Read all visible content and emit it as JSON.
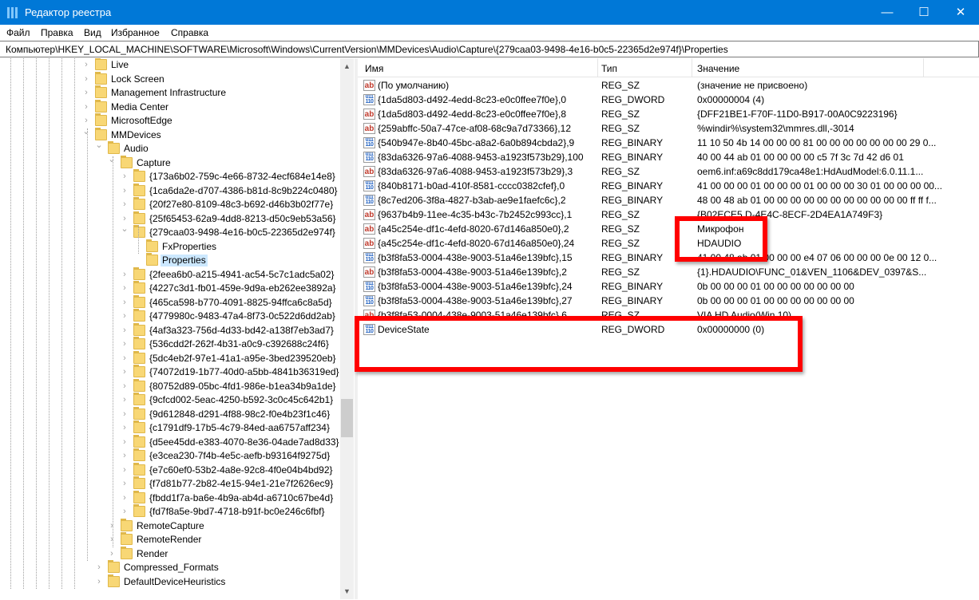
{
  "window": {
    "title": "Редактор реестра",
    "minimize": "—",
    "maximize": "☐",
    "close": "✕"
  },
  "menu": [
    "Файл",
    "Правка",
    "Вид",
    "Избранное",
    "Справка"
  ],
  "address": "Компьютер\\HKEY_LOCAL_MACHINE\\SOFTWARE\\Microsoft\\Windows\\CurrentVersion\\MMDevices\\Audio\\Capture\\{279caa03-9498-4e16-b0c5-22365d2e974f}\\Properties",
  "tree": [
    {
      "label": "Live",
      "level": 0,
      "state": "collapsed"
    },
    {
      "label": "Lock Screen",
      "level": 0,
      "state": "collapsed"
    },
    {
      "label": "Management Infrastructure",
      "level": 0,
      "state": "collapsed"
    },
    {
      "label": "Media Center",
      "level": 0,
      "state": "collapsed"
    },
    {
      "label": "MicrosoftEdge",
      "level": 0,
      "state": "collapsed"
    },
    {
      "label": "MMDevices",
      "level": 0,
      "state": "expanded"
    },
    {
      "label": "Audio",
      "level": 1,
      "state": "expanded"
    },
    {
      "label": "Capture",
      "level": 2,
      "state": "expanded"
    },
    {
      "label": "{173a6b02-759c-4e66-8732-4ecf684e14e8}",
      "level": 3,
      "state": "collapsed"
    },
    {
      "label": "{1ca6da2e-d707-4386-b81d-8c9b224c0480}",
      "level": 3,
      "state": "collapsed"
    },
    {
      "label": "{20f27e80-8109-48c3-b692-d46b3b02f77e}",
      "level": 3,
      "state": "collapsed"
    },
    {
      "label": "{25f65453-62a9-4dd8-8213-d50c9eb53a56}",
      "level": 3,
      "state": "collapsed"
    },
    {
      "label": "{279caa03-9498-4e16-b0c5-22365d2e974f}",
      "level": 3,
      "state": "expanded"
    },
    {
      "label": "FxProperties",
      "level": 4,
      "state": "leaf"
    },
    {
      "label": "Properties",
      "level": 4,
      "state": "leaf",
      "selected": true
    },
    {
      "label": "{2feea6b0-a215-4941-ac54-5c7c1adc5a02}",
      "level": 3,
      "state": "collapsed"
    },
    {
      "label": "{4227c3d1-fb01-459e-9d9a-eb262ee3892a}",
      "level": 3,
      "state": "collapsed"
    },
    {
      "label": "{465ca598-b770-4091-8825-94ffca6c8a5d}",
      "level": 3,
      "state": "collapsed"
    },
    {
      "label": "{4779980c-9483-47a4-8f73-0c522d6dd2ab}",
      "level": 3,
      "state": "collapsed"
    },
    {
      "label": "{4af3a323-756d-4d33-bd42-a138f7eb3ad7}",
      "level": 3,
      "state": "collapsed"
    },
    {
      "label": "{536cdd2f-262f-4b31-a0c9-c392688c24f6}",
      "level": 3,
      "state": "collapsed"
    },
    {
      "label": "{5dc4eb2f-97e1-41a1-a95e-3bed239520eb}",
      "level": 3,
      "state": "collapsed"
    },
    {
      "label": "{74072d19-1b77-40d0-a5bb-4841b36319ed}",
      "level": 3,
      "state": "collapsed"
    },
    {
      "label": "{80752d89-05bc-4fd1-986e-b1ea34b9a1de}",
      "level": 3,
      "state": "collapsed"
    },
    {
      "label": "{9cfcd002-5eac-4250-b592-3c0c45c642b1}",
      "level": 3,
      "state": "collapsed"
    },
    {
      "label": "{9d612848-d291-4f88-98c2-f0e4b23f1c46}",
      "level": 3,
      "state": "collapsed"
    },
    {
      "label": "{c1791df9-17b5-4c79-84ed-aa6757aff234}",
      "level": 3,
      "state": "collapsed"
    },
    {
      "label": "{d5ee45dd-e383-4070-8e36-04ade7ad8d33}",
      "level": 3,
      "state": "collapsed"
    },
    {
      "label": "{e3cea230-7f4b-4e5c-aefb-b93164f9275d}",
      "level": 3,
      "state": "collapsed"
    },
    {
      "label": "{e7c60ef0-53b2-4a8e-92c8-4f0e04b4bd92}",
      "level": 3,
      "state": "collapsed"
    },
    {
      "label": "{f7d81b77-2b82-4e15-94e1-21e7f2626ec9}",
      "level": 3,
      "state": "collapsed"
    },
    {
      "label": "{fbdd1f7a-ba6e-4b9a-ab4d-a6710c67be4d}",
      "level": 3,
      "state": "collapsed"
    },
    {
      "label": "{fd7f8a5e-9bd7-4718-b91f-bc0e246c6fbf}",
      "level": 3,
      "state": "collapsed"
    },
    {
      "label": "RemoteCapture",
      "level": 2,
      "state": "collapsed"
    },
    {
      "label": "RemoteRender",
      "level": 2,
      "state": "collapsed"
    },
    {
      "label": "Render",
      "level": 2,
      "state": "collapsed"
    },
    {
      "label": "Compressed_Formats",
      "level": 1,
      "state": "collapsed"
    },
    {
      "label": "DefaultDeviceHeuristics",
      "level": 1,
      "state": "collapsed"
    }
  ],
  "columns": {
    "name": "Имя",
    "type": "Тип",
    "value": "Значение"
  },
  "values": [
    {
      "name": "(По умолчанию)",
      "type": "REG_SZ",
      "value": "(значение не присвоено)",
      "icon": "string-value-icon"
    },
    {
      "name": "{1da5d803-d492-4edd-8c23-e0c0ffee7f0e},0",
      "type": "REG_DWORD",
      "value": "0x00000004 (4)",
      "icon": "binary-value-icon"
    },
    {
      "name": "{1da5d803-d492-4edd-8c23-e0c0ffee7f0e},8",
      "type": "REG_SZ",
      "value": "{DFF21BE1-F70F-11D0-B917-00A0C9223196}",
      "icon": "string-value-icon"
    },
    {
      "name": "{259abffc-50a7-47ce-af08-68c9a7d73366},12",
      "type": "REG_SZ",
      "value": "%windir%\\system32\\mmres.dll,-3014",
      "icon": "string-value-icon"
    },
    {
      "name": "{540b947e-8b40-45bc-a8a2-6a0b894cbda2},9",
      "type": "REG_BINARY",
      "value": "11 10 50 4b 14 00 00 00 81 00 00 00 00 00 00 00 29 0...",
      "icon": "binary-value-icon"
    },
    {
      "name": "{83da6326-97a6-4088-9453-a1923f573b29},100",
      "type": "REG_BINARY",
      "value": "40 00 44 ab 01 00 00 00 00 c5 7f 3c 7d 42 d6 01",
      "icon": "binary-value-icon"
    },
    {
      "name": "{83da6326-97a6-4088-9453-a1923f573b29},3",
      "type": "REG_SZ",
      "value": "oem6.inf:a69c8dd179ca48e1:HdAudModel:6.0.11.1...",
      "icon": "string-value-icon"
    },
    {
      "name": "{840b8171-b0ad-410f-8581-cccc0382cfef},0",
      "type": "REG_BINARY",
      "value": "41 00 00 00 01 00 00 00 01 00 00 00 30 01 00 00 00 00...",
      "icon": "binary-value-icon"
    },
    {
      "name": "{8c7ed206-3f8a-4827-b3ab-ae9e1faefc6c},2",
      "type": "REG_BINARY",
      "value": "48 00 48 ab 01 00 00 00 00 00 00 00 00 00 00 00 ff ff f...",
      "icon": "binary-value-icon"
    },
    {
      "name": "{9637b4b9-11ee-4c35-b43c-7b2452c993cc},1",
      "type": "REG_SZ",
      "value": "{B02ECE5        D-4E4C-8ECF-2D4EA1A749F3}",
      "icon": "string-value-icon"
    },
    {
      "name": "{a45c254e-df1c-4efd-8020-67d146a850e0},2",
      "type": "REG_SZ",
      "value": "Микрофон",
      "icon": "string-value-icon"
    },
    {
      "name": "{a45c254e-df1c-4efd-8020-67d146a850e0},24",
      "type": "REG_SZ",
      "value": "HDAUDIO",
      "icon": "string-value-icon"
    },
    {
      "name": "{b3f8fa53-0004-438e-9003-51a46e139bfc},15",
      "type": "REG_BINARY",
      "value": "41 00 48 ab 01 00 00 00 e4 07 06 00 00 00 0e 00 12 0...",
      "icon": "binary-value-icon"
    },
    {
      "name": "{b3f8fa53-0004-438e-9003-51a46e139bfc},2",
      "type": "REG_SZ",
      "value": "{1}.HDAUDIO\\FUNC_01&VEN_1106&DEV_0397&S...",
      "icon": "string-value-icon"
    },
    {
      "name": "{b3f8fa53-0004-438e-9003-51a46e139bfc},24",
      "type": "REG_BINARY",
      "value": "0b 00 00 00 01 00 00 00 00 00 00 00",
      "icon": "binary-value-icon"
    },
    {
      "name": "{b3f8fa53-0004-438e-9003-51a46e139bfc},27",
      "type": "REG_BINARY",
      "value": "0b 00 00 00 01 00 00 00 00 00 00 00",
      "icon": "binary-value-icon"
    },
    {
      "name": "{b3f8fa53-0004-438e-9003-51a46e139bfc},6",
      "type": "REG_SZ",
      "value": "VIA HD Audio(Win 10)",
      "icon": "string-value-icon"
    },
    {
      "name": "DeviceState",
      "type": "REG_DWORD",
      "value": "0x00000000 (0)",
      "icon": "binary-value-icon"
    }
  ],
  "highlight_color": "#ff0000",
  "accent": "#0078d7"
}
